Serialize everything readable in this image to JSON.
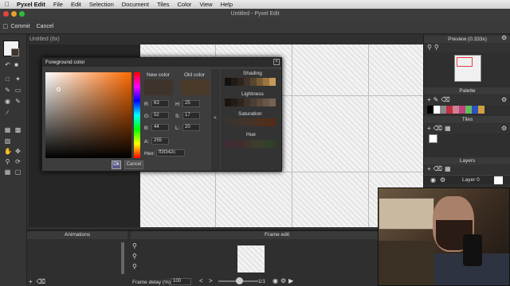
{
  "menubar": {
    "app": "Pyxel Edit",
    "items": [
      "File",
      "Edit",
      "Selection",
      "Document",
      "Tiles",
      "Color",
      "View",
      "Help"
    ]
  },
  "window": {
    "title": "Untitled - Pyxel Edit"
  },
  "toolbar": {
    "commit": "Commit",
    "cancel": "Cancel"
  },
  "document": {
    "tab": "Untitled   (8x)"
  },
  "panels": {
    "preview": "Preview (0.333x)",
    "palette": "Palette",
    "tiles": "Tiles",
    "layers": "Layers",
    "layer0": "Layer 0",
    "animations": "Animations",
    "frame_edit": "Frame edit",
    "frame_delay_label": "Frame delay (%)",
    "frame_delay": "100",
    "frame_count": "1/1"
  },
  "dialog": {
    "title": "Foreground color",
    "new_color_label": "New color",
    "old_color_label": "Old color",
    "r_label": "R:",
    "r": "63",
    "g_label": "G:",
    "g": "52",
    "b_label": "B:",
    "b": "44",
    "a_label": "A:",
    "a": "255",
    "h_label": "H:",
    "h": "25",
    "s_label": "S:",
    "s": "17",
    "l_label": "L:",
    "l": "20",
    "hex_label": "Hex:",
    "hex": "ff3f342c",
    "ok": "Ok",
    "cancel": "Cancel",
    "shading": "Shading",
    "lightness": "Lightness",
    "saturation": "Saturation",
    "hue": "Hue",
    "new_color": "#3f342c",
    "old_color": "#4a3a2a"
  }
}
